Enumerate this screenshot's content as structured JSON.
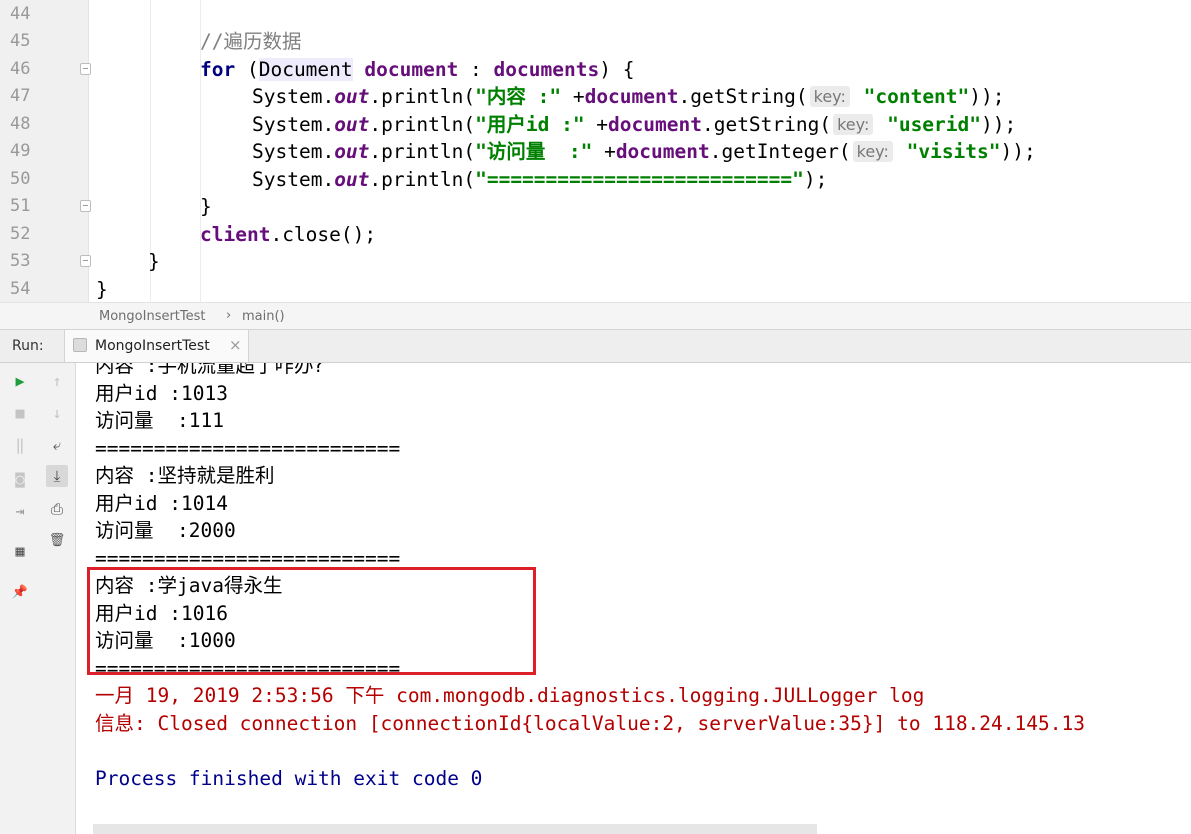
{
  "editor": {
    "line_numbers": [
      "44",
      "45",
      "46",
      "47",
      "48",
      "49",
      "50",
      "51",
      "52",
      "53",
      "54"
    ],
    "lines": {
      "l45": {
        "comment_slash": "//",
        "comment_text": "遍历数据"
      },
      "l46": {
        "kw_for": "for",
        "p1": " (",
        "class": "Document",
        "sp": " ",
        "var": "document",
        "p2": " : ",
        "iter": "documents",
        "p3": ") {"
      },
      "l47": {
        "sys": "System.",
        "out": "out",
        "println": ".println(",
        "q1": "\"",
        "label": "内容",
        "q2": " :\"",
        "plus": " +",
        "doc": "document",
        "call": ".getString(",
        "hint": "key:",
        "arg": " \"content\"",
        "end": "));"
      },
      "l48": {
        "sys": "System.",
        "out": "out",
        "println": ".println(",
        "q1": "\"",
        "label": "用户",
        "q2": "id :\"",
        "plus": " +",
        "doc": "document",
        "call": ".getString(",
        "hint": "key:",
        "arg": " \"userid\"",
        "end": "));"
      },
      "l49": {
        "sys": "System.",
        "out": "out",
        "println": ".println(",
        "q1": "\"",
        "label": "访问量",
        "q2": "  :\"",
        "plus": " +",
        "doc": "document",
        "call": ".getInteger(",
        "hint": "key:",
        "arg": " \"visits\"",
        "end": "));"
      },
      "l50": {
        "sys": "System.",
        "out": "out",
        "println": ".println(",
        "str": "\"==========================\"",
        "end": ");"
      },
      "l51": {
        "text": "}"
      },
      "l52": {
        "client": "client",
        "rest": ".close();"
      },
      "l53": {
        "text": "}"
      },
      "l54": {
        "text": "}"
      }
    }
  },
  "breadcrumb": {
    "class_name": "MongoInsertTest",
    "separator": "›",
    "method": "main()"
  },
  "run": {
    "label": "Run:",
    "tab_title": "MongoInsertTest",
    "tab_close": "×"
  },
  "console": {
    "l0": {
      "label": "内容",
      "rest": " :",
      "value": "手机流量超了咋办?"
    },
    "l1": {
      "label": "用户",
      "rest": "id :1013"
    },
    "l2": {
      "label": "访问量",
      "rest": "  :111"
    },
    "l3": {
      "text": "=========================="
    },
    "l4": {
      "label": "内容",
      "rest": " :",
      "value": "坚持就是胜利"
    },
    "l5": {
      "label": "用户",
      "rest": "id :1014"
    },
    "l6": {
      "label": "访问量",
      "rest": "  :2000"
    },
    "l7": {
      "text": "=========================="
    },
    "l8": {
      "label": "内容",
      "rest": " :",
      "value_a": "学",
      "value_b": "java",
      "value_c": "得永生"
    },
    "l9": {
      "label": "用户",
      "rest": "id :1016"
    },
    "l10": {
      "label": "访问量",
      "rest": "  :1000"
    },
    "l11": {
      "text": "=========================="
    },
    "l12": {
      "month": "一月",
      "date": " 19, 2019 2:53:56 ",
      "ampm": "下午",
      "logger": " com.mongodb.diagnostics.logging.JULLogger log"
    },
    "l13": {
      "label": "信息",
      "rest": ": Closed connection [connectionId{localValue:2, serverValue:35}] to 118.24.145.13"
    },
    "l14": {
      "text": "Process finished with exit code 0"
    }
  },
  "icons": {
    "rerun": "▶",
    "stop": "■",
    "pause": "‖",
    "camera": "◙",
    "login": "⇥",
    "layout": "▦",
    "pin": "📌",
    "up": "↑",
    "down": "↓",
    "wrap": "⤶",
    "scroll_end": "⤓",
    "print": "⎙",
    "trash": "🗑"
  },
  "colors": {
    "rerun_green": "#1e9e3c",
    "highlight_red": "#dd1f2a"
  }
}
